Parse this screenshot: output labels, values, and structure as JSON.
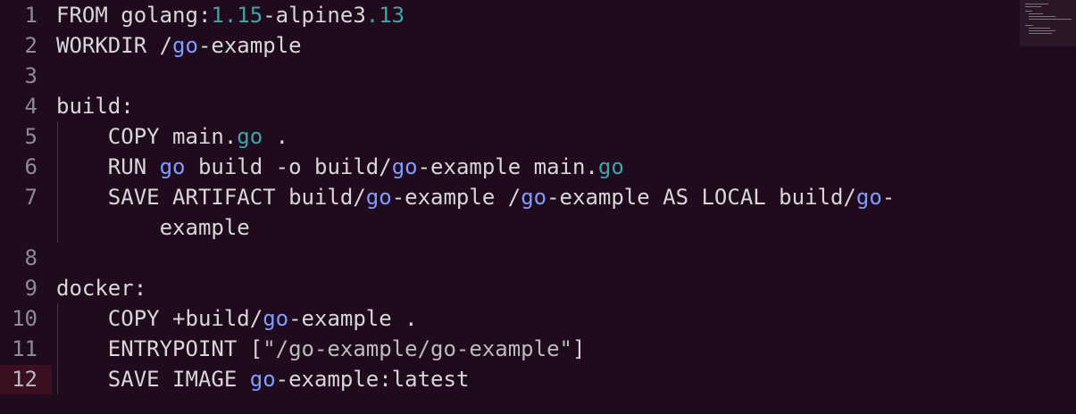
{
  "editor": {
    "lines": [
      {
        "num": "1",
        "parts": [
          {
            "t": "FROM golang:",
            "c": "kw"
          },
          {
            "t": "1.15",
            "c": "num"
          },
          {
            "t": "-alpine3",
            "c": "kw"
          },
          {
            "t": ".13",
            "c": "num"
          }
        ]
      },
      {
        "num": "2",
        "parts": [
          {
            "t": "WORKDIR /",
            "c": "kw"
          },
          {
            "t": "go",
            "c": "go"
          },
          {
            "t": "-example",
            "c": "kw"
          }
        ]
      },
      {
        "num": "3",
        "parts": []
      },
      {
        "num": "4",
        "parts": [
          {
            "t": "build:",
            "c": "kw"
          }
        ]
      },
      {
        "num": "5",
        "parts": [
          {
            "t": "    COPY main.",
            "c": "kw"
          },
          {
            "t": "go",
            "c": "goext"
          },
          {
            "t": " .",
            "c": "kw"
          }
        ]
      },
      {
        "num": "6",
        "parts": [
          {
            "t": "    RUN ",
            "c": "kw"
          },
          {
            "t": "go",
            "c": "go"
          },
          {
            "t": " build -o build/",
            "c": "kw"
          },
          {
            "t": "go",
            "c": "go"
          },
          {
            "t": "-example main.",
            "c": "kw"
          },
          {
            "t": "go",
            "c": "goext"
          }
        ]
      },
      {
        "num": "7",
        "parts": [
          {
            "t": "    SAVE ARTIFACT build/",
            "c": "kw"
          },
          {
            "t": "go",
            "c": "go"
          },
          {
            "t": "-example /",
            "c": "kw"
          },
          {
            "t": "go",
            "c": "go"
          },
          {
            "t": "-example AS LOCAL build/",
            "c": "kw"
          },
          {
            "t": "go",
            "c": "go"
          },
          {
            "t": "-",
            "c": "kw"
          }
        ]
      },
      {
        "num": "",
        "parts": [
          {
            "t": "        example",
            "c": "kw"
          }
        ]
      },
      {
        "num": "8",
        "parts": []
      },
      {
        "num": "9",
        "parts": [
          {
            "t": "docker:",
            "c": "kw"
          }
        ]
      },
      {
        "num": "10",
        "parts": [
          {
            "t": "    COPY +build/",
            "c": "kw"
          },
          {
            "t": "go",
            "c": "go"
          },
          {
            "t": "-example .",
            "c": "kw"
          }
        ]
      },
      {
        "num": "11",
        "parts": [
          {
            "t": "    ENTRYPOINT [",
            "c": "kw"
          },
          {
            "t": "\"/go-example/go-example\"",
            "c": "str"
          },
          {
            "t": "]",
            "c": "kw"
          }
        ]
      },
      {
        "num": "12",
        "parts": [
          {
            "t": "    SAVE IMAGE ",
            "c": "kw"
          },
          {
            "t": "go",
            "c": "go"
          },
          {
            "t": "-example:latest",
            "c": "kw"
          }
        ]
      }
    ]
  }
}
